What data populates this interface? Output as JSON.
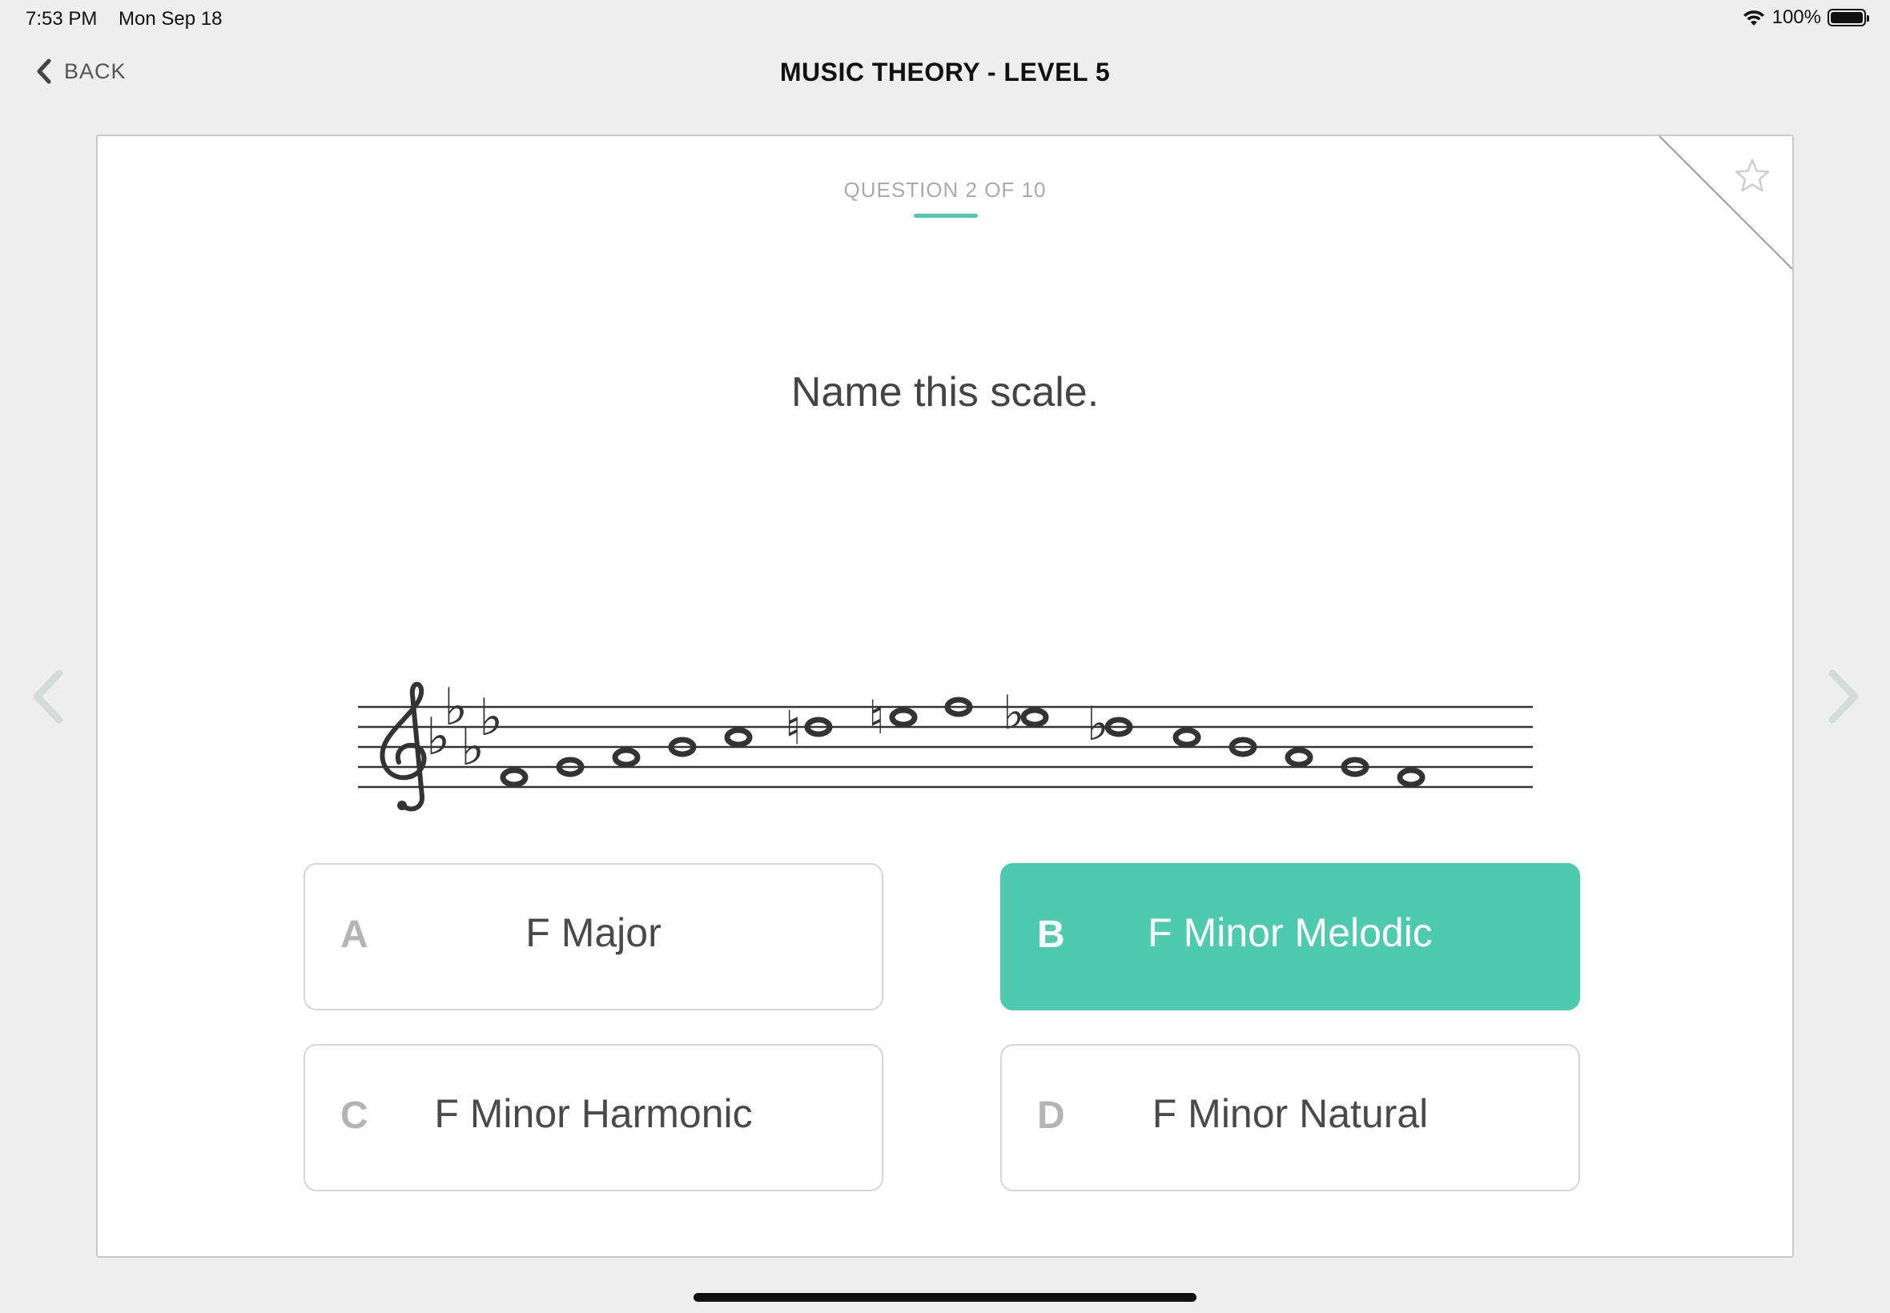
{
  "status": {
    "time": "7:53 PM",
    "date": "Mon Sep 18",
    "battery_pct": "100%",
    "battery_level": 1.0
  },
  "nav": {
    "back_label": "BACK",
    "title": "MUSIC THEORY - LEVEL 5"
  },
  "quiz": {
    "counter": "QUESTION 2 OF 10",
    "prompt": "Name this scale.",
    "notation": {
      "clef": "treble",
      "key_signature": [
        "Bb",
        "Eb",
        "Ab",
        "Db"
      ],
      "notes": [
        "F4",
        "G4",
        "Ab4",
        "Bb4",
        "C5",
        "D5 natural",
        "E5 natural",
        "F5",
        "Eb5 flat",
        "Db5 flat",
        "C5",
        "Bb4",
        "Ab4",
        "G4",
        "F4"
      ]
    },
    "answers": [
      {
        "letter": "A",
        "label": "F Major",
        "selected": false
      },
      {
        "letter": "B",
        "label": "F Minor Melodic",
        "selected": true
      },
      {
        "letter": "C",
        "label": "F Minor Harmonic",
        "selected": false
      },
      {
        "letter": "D",
        "label": "F Minor Natural",
        "selected": false
      }
    ]
  },
  "colors": {
    "accent": "#4ecaaf",
    "background": "#eeeeee",
    "card": "#ffffff"
  },
  "icons": {
    "back": "chevron-left-icon",
    "favorite": "star-outline-icon",
    "prev": "chevron-left-icon",
    "next": "chevron-right-icon",
    "wifi": "wifi-icon",
    "battery": "battery-icon"
  }
}
